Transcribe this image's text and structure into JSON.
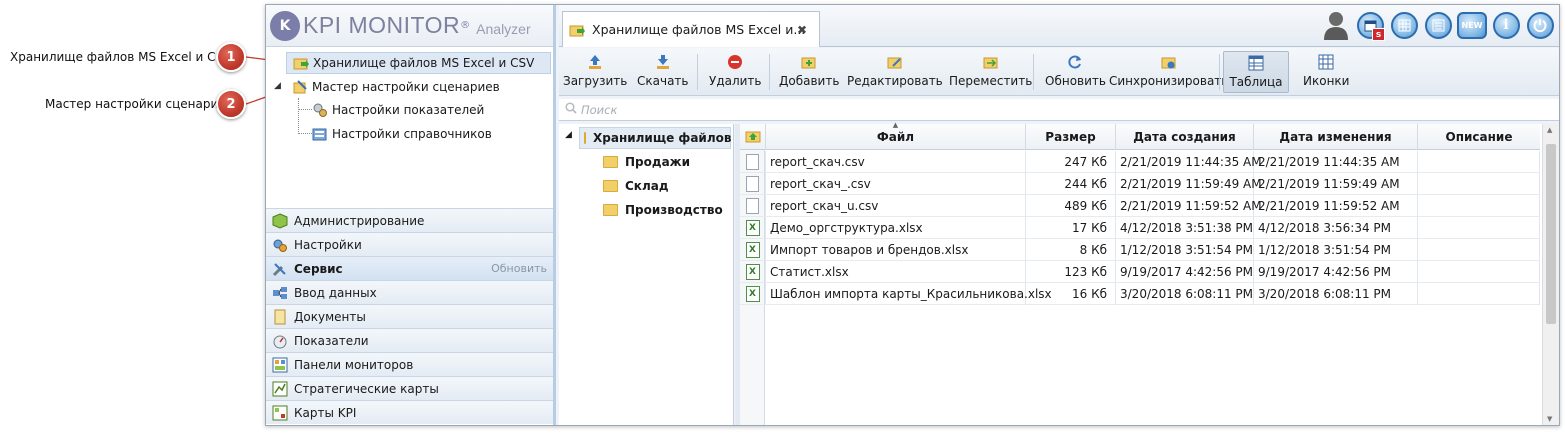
{
  "callouts": [
    {
      "label": "Хранилище файлов MS Excel и CSV",
      "num": "1"
    },
    {
      "label": "Мастер настройки сценариев",
      "num": "2"
    }
  ],
  "logo": {
    "brand": "KPI MONITOR",
    "reg": "®",
    "sub": "Analyzer",
    "mark": "K"
  },
  "tree": {
    "item1": "Хранилище файлов MS Excel и CSV",
    "item2": "Мастер настройки сценариев",
    "item2_child1": "Настройки показателей",
    "item2_child2": "Настройки справочников"
  },
  "nav": {
    "items": [
      {
        "label": "Администрирование"
      },
      {
        "label": "Настройки"
      },
      {
        "label": "Сервис",
        "extra": "Обновить"
      },
      {
        "label": "Ввод данных"
      },
      {
        "label": "Документы"
      },
      {
        "label": "Показатели"
      },
      {
        "label": "Панели мониторов"
      },
      {
        "label": "Стратегические карты"
      },
      {
        "label": "Карты KPI"
      }
    ]
  },
  "tab": {
    "title": "Хранилище файлов MS Excel и...",
    "close": "✖"
  },
  "topbar": {
    "badge": "s",
    "new": "NEW",
    "info": "i"
  },
  "toolbar": {
    "upload": "Загрузить",
    "download": "Скачать",
    "delete": "Удалить",
    "add": "Добавить",
    "edit": "Редактировать",
    "move": "Переместить",
    "refresh": "Обновить",
    "sync": "Синхронизировать",
    "table": "Таблица",
    "icons": "Иконки"
  },
  "search": {
    "placeholder": "Поиск"
  },
  "folders": {
    "root": "Хранилище файлов",
    "children": [
      "Продажи",
      "Склад",
      "Производство"
    ]
  },
  "table": {
    "columns": {
      "file": "Файл",
      "size": "Размер",
      "created": "Дата создания",
      "modified": "Дата изменения",
      "desc": "Описание"
    },
    "rows": [
      {
        "type": "csv",
        "file": "report_скач.csv",
        "size": "247 Кб",
        "created": "2/21/2019 11:44:35 AM",
        "modified": "2/21/2019 11:44:35 AM",
        "desc": ""
      },
      {
        "type": "csv",
        "file": "report_скач_.csv",
        "size": "244 Кб",
        "created": "2/21/2019 11:59:49 AM",
        "modified": "2/21/2019 11:59:49 AM",
        "desc": ""
      },
      {
        "type": "csv",
        "file": "report_скач_u.csv",
        "size": "489 Кб",
        "created": "2/21/2019 11:59:52 AM",
        "modified": "2/21/2019 11:59:52 AM",
        "desc": ""
      },
      {
        "type": "xlsx",
        "file": "Демо_оргструктура.xlsx",
        "size": "17 Кб",
        "created": "4/12/2018 3:51:38 PM",
        "modified": "4/12/2018 3:56:34 PM",
        "desc": ""
      },
      {
        "type": "xlsx",
        "file": "Импорт товаров и брендов.xlsx",
        "size": "8 Кб",
        "created": "1/12/2018 3:51:54 PM",
        "modified": "1/12/2018 3:51:54 PM",
        "desc": ""
      },
      {
        "type": "xlsx",
        "file": "Статист.xlsx",
        "size": "123 Кб",
        "created": "9/19/2017 4:42:56 PM",
        "modified": "9/19/2017 4:42:56 PM",
        "desc": ""
      },
      {
        "type": "xlsx",
        "file": "Шаблон импорта карты_Красильникова.xlsx",
        "size": "16 Кб",
        "created": "3/20/2018 6:08:11 PM",
        "modified": "3/20/2018 6:08:11 PM",
        "desc": ""
      }
    ]
  },
  "colors": {
    "accent": "#2c6db0",
    "callout": "#c0392b",
    "selection": "#dde8f4"
  }
}
